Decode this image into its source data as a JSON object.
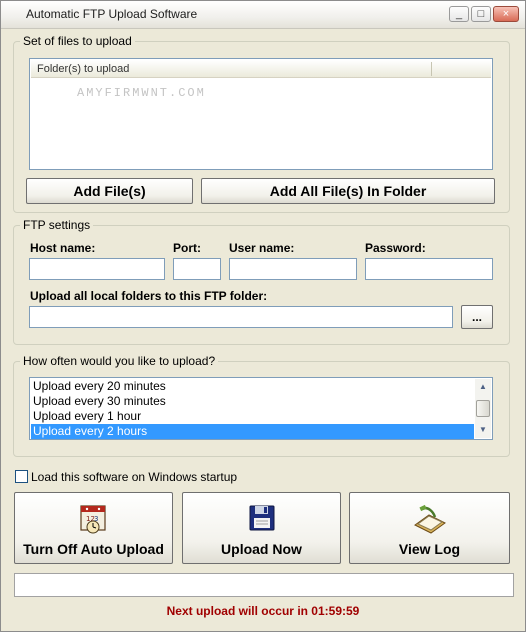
{
  "window": {
    "title": "Automatic FTP Upload Software",
    "minimize": "_",
    "maximize": "□",
    "close": "×"
  },
  "files_group": {
    "legend": "Set of files to upload",
    "column_header": "Folder(s) to upload",
    "watermark": "AMYFIRMWNT.COM",
    "add_files_label": "Add File(s)",
    "add_all_label": "Add All File(s) In Folder"
  },
  "ftp_group": {
    "legend": "FTP settings",
    "host_label": "Host name:",
    "port_label": "Port:",
    "user_label": "User name:",
    "password_label": "Password:",
    "host_value": "",
    "port_value": "",
    "user_value": "",
    "password_value": "",
    "folder_label": "Upload all local folders to this FTP folder:",
    "folder_value": "",
    "browse_label": "..."
  },
  "frequency_group": {
    "legend": "How often would you like to upload?",
    "options": [
      "Upload every 20 minutes",
      "Upload every 30 minutes",
      "Upload every 1 hour",
      "Upload every 2 hours"
    ],
    "selected_index": 3
  },
  "startup": {
    "label": "Load this software on Windows startup",
    "checked": false
  },
  "actions": {
    "turn_off_label": "Turn Off Auto Upload",
    "upload_now_label": "Upload Now",
    "view_log_label": "View Log"
  },
  "status": {
    "next_upload": "Next upload will occur in 01:59:59",
    "color": "#a00000"
  },
  "colors": {
    "window_bg": "#ece9d8",
    "selection": "#3399ff",
    "border_blue": "#7f9db9"
  }
}
